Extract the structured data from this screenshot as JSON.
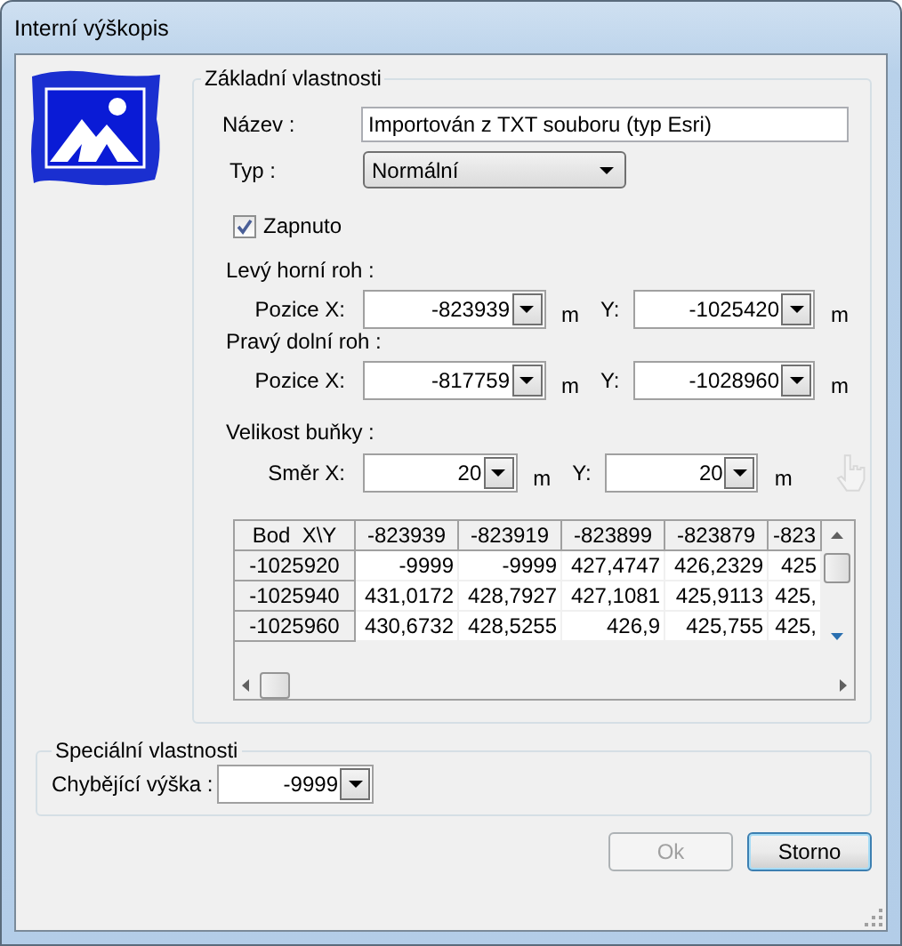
{
  "window": {
    "title": "Interní výškopis"
  },
  "basic": {
    "title": "Základní vlastnosti",
    "name_label": "Název :",
    "name_value": "Importován z TXT souboru (typ Esri)",
    "type_label": "Typ :",
    "type_value": "Normální",
    "enabled": {
      "label": "Zapnuto",
      "checked": true
    },
    "sections": [
      {
        "title": "Levý horní roh :",
        "kind": "position",
        "fields": [
          {
            "label": "Pozice X:",
            "value": "-823939",
            "unit": "m"
          },
          {
            "label": "Y:",
            "value": "-1025420",
            "unit": "m"
          }
        ]
      },
      {
        "title": "Pravý dolní roh :",
        "kind": "position",
        "fields": [
          {
            "label": "Pozice X:",
            "value": "-817759",
            "unit": "m"
          },
          {
            "label": "Y:",
            "value": "-1028960",
            "unit": "m"
          }
        ]
      },
      {
        "title": "Velikost buňky :",
        "kind": "size",
        "fields": [
          {
            "label": "Směr X:",
            "value": "20",
            "unit": "m"
          },
          {
            "label": "Y:",
            "value": "20",
            "unit": "m"
          }
        ]
      }
    ],
    "grid": {
      "corner": "Bod  X\\Y",
      "columns": [
        "-823939",
        "-823919",
        "-823899",
        "-823879",
        "-823"
      ],
      "rows": [
        {
          "header": "-1025920",
          "cells": [
            "-9999",
            "-9999",
            "427,4747",
            "426,2329",
            "425"
          ]
        },
        {
          "header": "-1025940",
          "cells": [
            "431,0172",
            "428,7927",
            "427,1081",
            "425,9113",
            "425,"
          ]
        },
        {
          "header": "-1025960",
          "cells": [
            "430,6732",
            "428,5255",
            "426,9",
            "425,755",
            "425,"
          ]
        }
      ]
    }
  },
  "special": {
    "title": "Speciální vlastnosti",
    "missing_label": "Chybějící výška :",
    "missing_value": "-9999"
  },
  "buttons": [
    {
      "label": "Ok",
      "disabled": true,
      "default": false
    },
    {
      "label": "Storno",
      "disabled": false,
      "default": true
    }
  ]
}
